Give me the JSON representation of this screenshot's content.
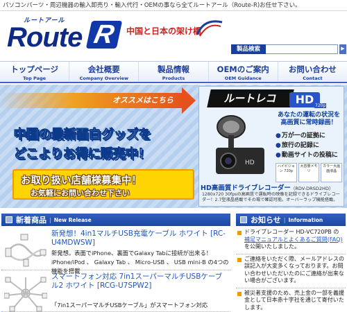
{
  "topbar": {
    "text": "パソコンパーツ・周辺機器の輸入卸売り・輸入代行・OEMの事なら全てルートアール（Route-R)お任せ下さい。"
  },
  "header": {
    "logo_small": "ルートアール",
    "logo_main": "Route",
    "logo_r": "R",
    "slogan": "中国と日本の架け橋",
    "search_label": "製品検索",
    "search_value": "",
    "search_button": "▶"
  },
  "nav": [
    {
      "jp": "トップページ",
      "en": "Top Page"
    },
    {
      "jp": "会社概要",
      "en": "Company Overview"
    },
    {
      "jp": "製品情報",
      "en": "Products"
    },
    {
      "jp": "OEMのご案内",
      "en": "OEM Guidance"
    },
    {
      "jp": "お問い合わせ",
      "en": "Contact"
    }
  ],
  "banner": {
    "osusume": "オススメはこちら",
    "line1": "中国の最新面白グッズを",
    "line2": "どこよりお得に販売中！",
    "yellow1": "お取り扱い店舗様募集中！",
    "yellow2": "お気軽にお問い合わせ下さい",
    "product": {
      "title": "ルートレコ",
      "hd": "HD",
      "hd_sub": "720p",
      "head": "あなたの運転の状況を高画質に常時録画！",
      "bullets": [
        "万が一の証拠に",
        "旅行の記録に",
        "動画サイトの投稿に"
      ],
      "features": [
        "ハイビジョン 720p",
        "大容量メモリ",
        "カラー大画面液晶"
      ],
      "name": "HD高画質ドライブレコーダー",
      "model": "（RDV-DRSD2HD）",
      "desc": "1280x720 30fpsの高画質で運転時の映像を記録できるドライブレコーダー！2.7型液晶搭載でその場で確認可能。オーバーラップ機能搭載。"
    }
  },
  "new_release": {
    "jp": "新着商品",
    "en": "New Release",
    "items": [
      {
        "title": "新発想！4in1マルチUSB充電ケーブル ホワイト [RC-U4MDWSW]",
        "desc": "新発想。表面でiPhone、裏面でGalaxy Tabに接続が出来る！iPhone/iPod 、 Galaxy Tab 、 Micro-USB 、 USB mini-B の4つの機能を搭載"
      },
      {
        "title": "スマートフォン対応 7in1スーパーマルチUSBケーブル2 ホワイト [RCG-U7SPW2]",
        "desc": "「7in1スーパーマルチUSBケーブル」がスマートフォン対応"
      }
    ]
  },
  "info": {
    "jp": "お知らせ",
    "en": "Information",
    "items": [
      {
        "pre": "ドライブレコーダー HD-VC720PB の",
        "link": "補足マニュアルとよくあるご質問(FAQ)",
        "post": "を公開いたしました。"
      },
      {
        "pre": "ご連絡をいただく際、メールアドレスの誤記入が大変多くなっております。お問い合わせいただいたのにご連絡が出来ない場合がございます。",
        "link": "",
        "post": ""
      },
      {
        "pre": "被災者支援のため、売上金の一部を義援金として日本赤十字社を通じて寄付いたします。",
        "link": "",
        "post": ""
      }
    ]
  },
  "colors": {
    "brand_blue": "#1a3f9a",
    "accent_red": "#d21e1e",
    "banner_yellow": "#ffd400",
    "link_blue": "#1d56c5"
  }
}
